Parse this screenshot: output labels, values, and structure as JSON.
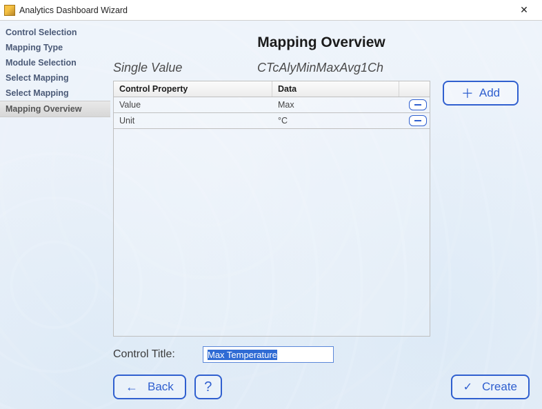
{
  "window": {
    "title": "Analytics Dashboard Wizard"
  },
  "sidebar": {
    "steps": [
      {
        "label": "Control Selection"
      },
      {
        "label": "Mapping Type"
      },
      {
        "label": "Module Selection"
      },
      {
        "label": "Select Mapping"
      },
      {
        "label": "Select Mapping"
      },
      {
        "label": "Mapping Overview"
      }
    ]
  },
  "page": {
    "title": "Mapping Overview",
    "control_kind": "Single Value",
    "module_type": "CTcAlyMinMaxAvg1Ch"
  },
  "table": {
    "headers": {
      "col1": "Control Property",
      "col2": "Data"
    },
    "rows": [
      {
        "property": "Value",
        "data": "Max"
      },
      {
        "property": "Unit",
        "data": "°C"
      }
    ]
  },
  "add_button": {
    "label": "Add"
  },
  "control_title": {
    "label": "Control Title:",
    "value": "Max Temperature"
  },
  "footer": {
    "back": "Back",
    "help": "?",
    "create": "Create"
  }
}
